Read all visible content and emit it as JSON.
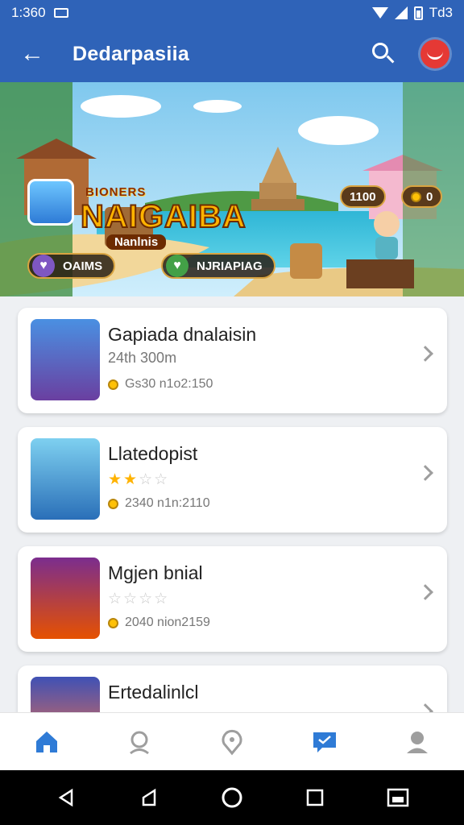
{
  "status_bar": {
    "time": "1:360",
    "right_text": "Td3"
  },
  "app_bar": {
    "title": "Dedarpasiia"
  },
  "banner": {
    "logo_subtitle": "BIONERS",
    "logo_title": "NAIGAIBA",
    "logo_tag": "Nanlnis",
    "counter_1": "1100",
    "counter_2": "0",
    "pill_1": "OAIMS",
    "pill_2": "NJRIAPIAG"
  },
  "games": [
    {
      "name": "Gapiada dnalaisin",
      "sub": "24th 300m",
      "meta": "Gs30 n1o2:150",
      "rating": null
    },
    {
      "name": "Llatedopist",
      "sub": "",
      "meta": "2340 n1n:2110",
      "rating": 2.5
    },
    {
      "name": "Mgjen bnial",
      "sub": "",
      "meta": "2040 nion2159",
      "rating": 0
    },
    {
      "name": "Ertedalinlcl",
      "sub": "",
      "meta": "",
      "rating": null
    }
  ],
  "colors": {
    "primary": "#2f63b8",
    "nav_active": "#2f7bd6",
    "nav_inactive": "#9e9e9e",
    "star": "#ffb300"
  },
  "bottom_nav": {
    "icons": [
      "home-icon",
      "profile-icon",
      "location-icon",
      "chat-icon",
      "account-icon"
    ],
    "active_index": 3
  }
}
